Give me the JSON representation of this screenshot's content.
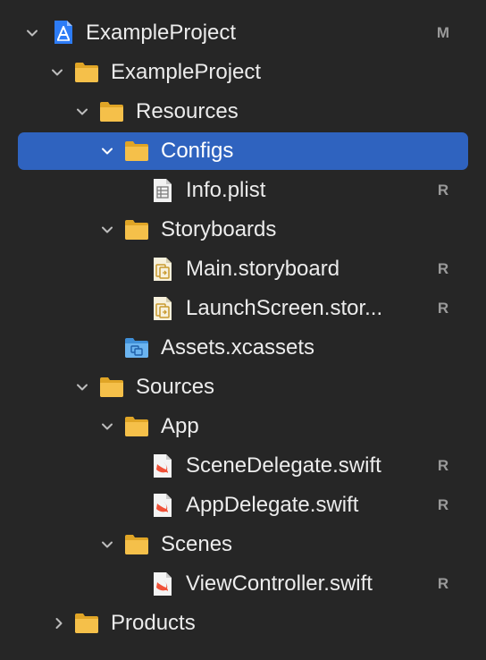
{
  "navigator": {
    "items": [
      {
        "label": "ExampleProject",
        "badge": "M",
        "icon": "xcode-project-icon",
        "disclosure": "expanded"
      },
      {
        "label": "ExampleProject",
        "badge": "",
        "icon": "folder-icon",
        "disclosure": "expanded"
      },
      {
        "label": "Resources",
        "badge": "",
        "icon": "folder-icon",
        "disclosure": "expanded"
      },
      {
        "label": "Configs",
        "badge": "",
        "icon": "folder-icon",
        "disclosure": "expanded",
        "selected": true
      },
      {
        "label": "Info.plist",
        "badge": "R",
        "icon": "plist-file-icon",
        "disclosure": "none"
      },
      {
        "label": "Storyboards",
        "badge": "",
        "icon": "folder-icon",
        "disclosure": "expanded"
      },
      {
        "label": "Main.storyboard",
        "badge": "R",
        "icon": "storyboard-file-icon",
        "disclosure": "none"
      },
      {
        "label": "LaunchScreen.stor...",
        "badge": "R",
        "icon": "storyboard-file-icon",
        "disclosure": "none"
      },
      {
        "label": "Assets.xcassets",
        "badge": "",
        "icon": "asset-catalog-icon",
        "disclosure": "none"
      },
      {
        "label": "Sources",
        "badge": "",
        "icon": "folder-icon",
        "disclosure": "expanded"
      },
      {
        "label": "App",
        "badge": "",
        "icon": "folder-icon",
        "disclosure": "expanded"
      },
      {
        "label": "SceneDelegate.swift",
        "badge": "R",
        "icon": "swift-file-icon",
        "disclosure": "none"
      },
      {
        "label": "AppDelegate.swift",
        "badge": "R",
        "icon": "swift-file-icon",
        "disclosure": "none"
      },
      {
        "label": "Scenes",
        "badge": "",
        "icon": "folder-icon",
        "disclosure": "expanded"
      },
      {
        "label": "ViewController.swift",
        "badge": "R",
        "icon": "swift-file-icon",
        "disclosure": "none"
      },
      {
        "label": "Products",
        "badge": "",
        "icon": "folder-icon",
        "disclosure": "collapsed"
      }
    ]
  },
  "colors": {
    "background": "#262626",
    "selection": "#2f63bf",
    "folder": "#f5c04a",
    "badge": "#9a9a9a",
    "text": "#ececec"
  }
}
